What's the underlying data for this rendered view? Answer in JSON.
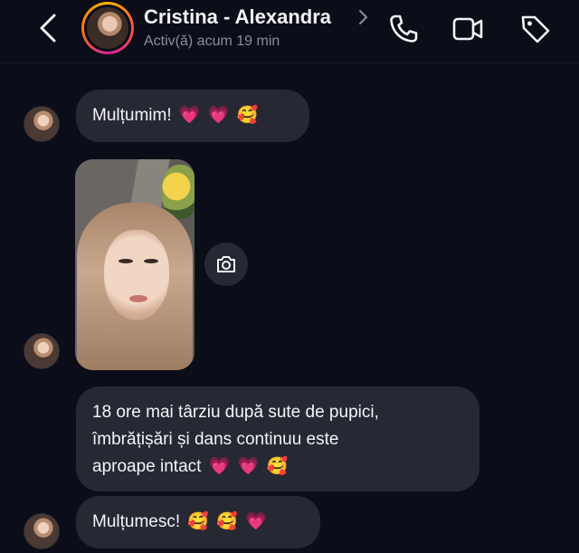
{
  "header": {
    "contact_name": "Cristina - Alexandra",
    "status": "Activ(ă) acum 19 min",
    "icons": [
      "back-chevron-icon",
      "chevron-right-icon",
      "phone-icon",
      "video-icon",
      "tag-icon"
    ]
  },
  "messages": [
    {
      "text": "Mulțumim!",
      "emojis": [
        "💗",
        "💗",
        "🥰"
      ]
    },
    {
      "type": "photo",
      "action_icon": "camera-icon"
    },
    {
      "text": "18 ore mai târziu după sute de pupici,\nîmbrățișări și dans continuu este\naproape intact",
      "emojis": [
        "💗",
        "💗",
        "🥰"
      ]
    },
    {
      "text": "Mulțumesc!",
      "emojis": [
        "🥰",
        "🥰",
        "💗"
      ]
    }
  ],
  "colors": {
    "background": "#0b0d18",
    "bubble": "#262833",
    "text": "#f4f4f7",
    "status_text": "#8b8d99"
  }
}
